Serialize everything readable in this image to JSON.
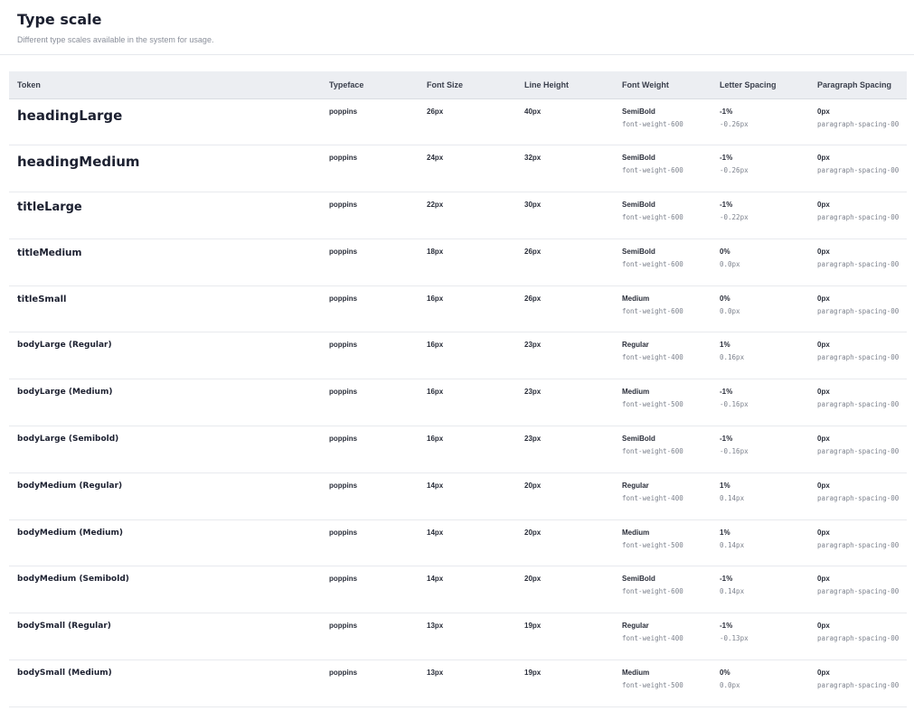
{
  "header": {
    "title": "Type scale",
    "subtitle": "Different type scales available in the system for usage."
  },
  "table": {
    "columns": [
      "Token",
      "Typeface",
      "Font Size",
      "Line Height",
      "Font Weight",
      "Letter Spacing",
      "Paragraph Spacing"
    ],
    "rows": [
      {
        "token": "headingLarge",
        "typeface": "poppins",
        "font_size": "26px",
        "line_height": "40px",
        "weight_name": "SemiBold",
        "weight_token": "font-weight-600",
        "letter_pct": "-1%",
        "letter_px": "-0.26px",
        "para_px": "0px",
        "para_token": "paragraph-spacing-00"
      },
      {
        "token": "headingMedium",
        "typeface": "poppins",
        "font_size": "24px",
        "line_height": "32px",
        "weight_name": "SemiBold",
        "weight_token": "font-weight-600",
        "letter_pct": "-1%",
        "letter_px": "-0.26px",
        "para_px": "0px",
        "para_token": "paragraph-spacing-00"
      },
      {
        "token": "titleLarge",
        "typeface": "poppins",
        "font_size": "22px",
        "line_height": "30px",
        "weight_name": "SemiBold",
        "weight_token": "font-weight-600",
        "letter_pct": "-1%",
        "letter_px": "-0.22px",
        "para_px": "0px",
        "para_token": "paragraph-spacing-00"
      },
      {
        "token": "titleMedium",
        "typeface": "poppins",
        "font_size": "18px",
        "line_height": "26px",
        "weight_name": "SemiBold",
        "weight_token": "font-weight-600",
        "letter_pct": "0%",
        "letter_px": "0.0px",
        "para_px": "0px",
        "para_token": "paragraph-spacing-00"
      },
      {
        "token": "titleSmall",
        "typeface": "poppins",
        "font_size": "16px",
        "line_height": "26px",
        "weight_name": "Medium",
        "weight_token": "font-weight-600",
        "letter_pct": "0%",
        "letter_px": "0.0px",
        "para_px": "0px",
        "para_token": "paragraph-spacing-00"
      },
      {
        "token": "bodyLarge (Regular)",
        "typeface": "poppins",
        "font_size": "16px",
        "line_height": "23px",
        "weight_name": "Regular",
        "weight_token": "font-weight-400",
        "letter_pct": "1%",
        "letter_px": "0.16px",
        "para_px": "0px",
        "para_token": "paragraph-spacing-00"
      },
      {
        "token": "bodyLarge (Medium)",
        "typeface": "poppins",
        "font_size": "16px",
        "line_height": "23px",
        "weight_name": "Medium",
        "weight_token": "font-weight-500",
        "letter_pct": "-1%",
        "letter_px": "-0.16px",
        "para_px": "0px",
        "para_token": "paragraph-spacing-00"
      },
      {
        "token": "bodyLarge (Semibold)",
        "typeface": "poppins",
        "font_size": "16px",
        "line_height": "23px",
        "weight_name": "SemiBold",
        "weight_token": "font-weight-600",
        "letter_pct": "-1%",
        "letter_px": "-0.16px",
        "para_px": "0px",
        "para_token": "paragraph-spacing-00"
      },
      {
        "token": "bodyMedium (Regular)",
        "typeface": "poppins",
        "font_size": "14px",
        "line_height": "20px",
        "weight_name": "Regular",
        "weight_token": "font-weight-400",
        "letter_pct": "1%",
        "letter_px": "0.14px",
        "para_px": "0px",
        "para_token": "paragraph-spacing-00"
      },
      {
        "token": "bodyMedium (Medium)",
        "typeface": "poppins",
        "font_size": "14px",
        "line_height": "20px",
        "weight_name": "Medium",
        "weight_token": "font-weight-500",
        "letter_pct": "1%",
        "letter_px": "0.14px",
        "para_px": "0px",
        "para_token": "paragraph-spacing-00"
      },
      {
        "token": "bodyMedium (Semibold)",
        "typeface": "poppins",
        "font_size": "14px",
        "line_height": "20px",
        "weight_name": "SemiBold",
        "weight_token": "font-weight-600",
        "letter_pct": "-1%",
        "letter_px": "0.14px",
        "para_px": "0px",
        "para_token": "paragraph-spacing-00"
      },
      {
        "token": "bodySmall (Regular)",
        "typeface": "poppins",
        "font_size": "13px",
        "line_height": "19px",
        "weight_name": "Regular",
        "weight_token": "font-weight-400",
        "letter_pct": "-1%",
        "letter_px": "-0.13px",
        "para_px": "0px",
        "para_token": "paragraph-spacing-00"
      },
      {
        "token": "bodySmall (Medium)",
        "typeface": "poppins",
        "font_size": "13px",
        "line_height": "19px",
        "weight_name": "Medium",
        "weight_token": "font-weight-500",
        "letter_pct": "0%",
        "letter_px": "0.0px",
        "para_px": "0px",
        "para_token": "paragraph-spacing-00"
      }
    ]
  }
}
